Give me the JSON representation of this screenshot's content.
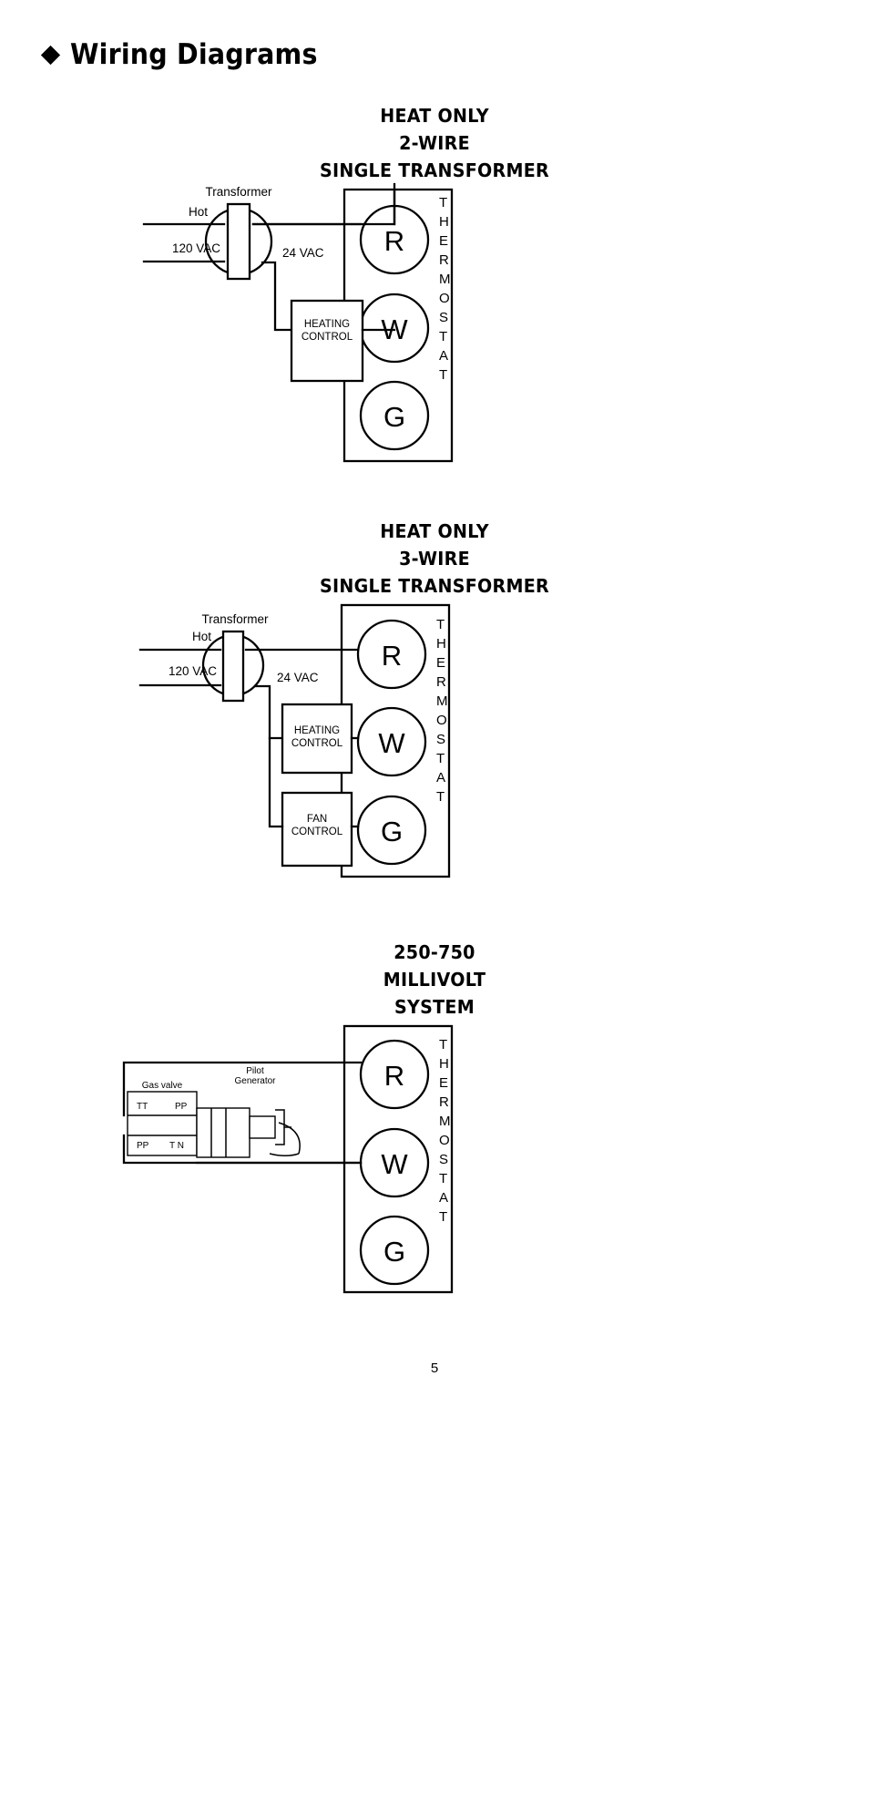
{
  "page": {
    "title": "Wiring Diagrams",
    "bullet_icon": "diamond-bullet",
    "page_number": "5"
  },
  "diagrams": [
    {
      "id": "heat-only-2-wire",
      "heading_lines": [
        "HEAT ONLY",
        "2-WIRE",
        "SINGLE TRANSFORMER"
      ],
      "labels": {
        "transformer": "Transformer",
        "hot": "Hot",
        "line_voltage": "120 VAC",
        "control_voltage": "24 VAC",
        "control_box": [
          "HEATING",
          "CONTROL"
        ]
      },
      "thermostat": {
        "vertical_label": "THERMOSTAT",
        "terminals": [
          "R",
          "W",
          "G"
        ]
      }
    },
    {
      "id": "heat-only-3-wire",
      "heading_lines": [
        "HEAT ONLY",
        "3-WIRE",
        "SINGLE TRANSFORMER"
      ],
      "labels": {
        "transformer": "Transformer",
        "hot": "Hot",
        "line_voltage": "120 VAC",
        "control_voltage": "24 VAC",
        "heating_box": [
          "HEATING",
          "CONTROL"
        ],
        "fan_box": [
          "FAN",
          "CONTROL"
        ]
      },
      "thermostat": {
        "vertical_label": "THERMOSTAT",
        "terminals": [
          "R",
          "W",
          "G"
        ]
      }
    },
    {
      "id": "millivolt-system",
      "heading_lines": [
        "250-750",
        "MILLIVOLT",
        "SYSTEM"
      ],
      "labels": {
        "gas_valve": "Gas valve",
        "pilot_generator": [
          "Pilot",
          "Generator"
        ],
        "terminals": [
          "TT",
          "PP",
          "PP",
          "T N"
        ]
      },
      "thermostat": {
        "vertical_label": "THERMOSTAT",
        "terminals": [
          "R",
          "W",
          "G"
        ]
      }
    }
  ]
}
